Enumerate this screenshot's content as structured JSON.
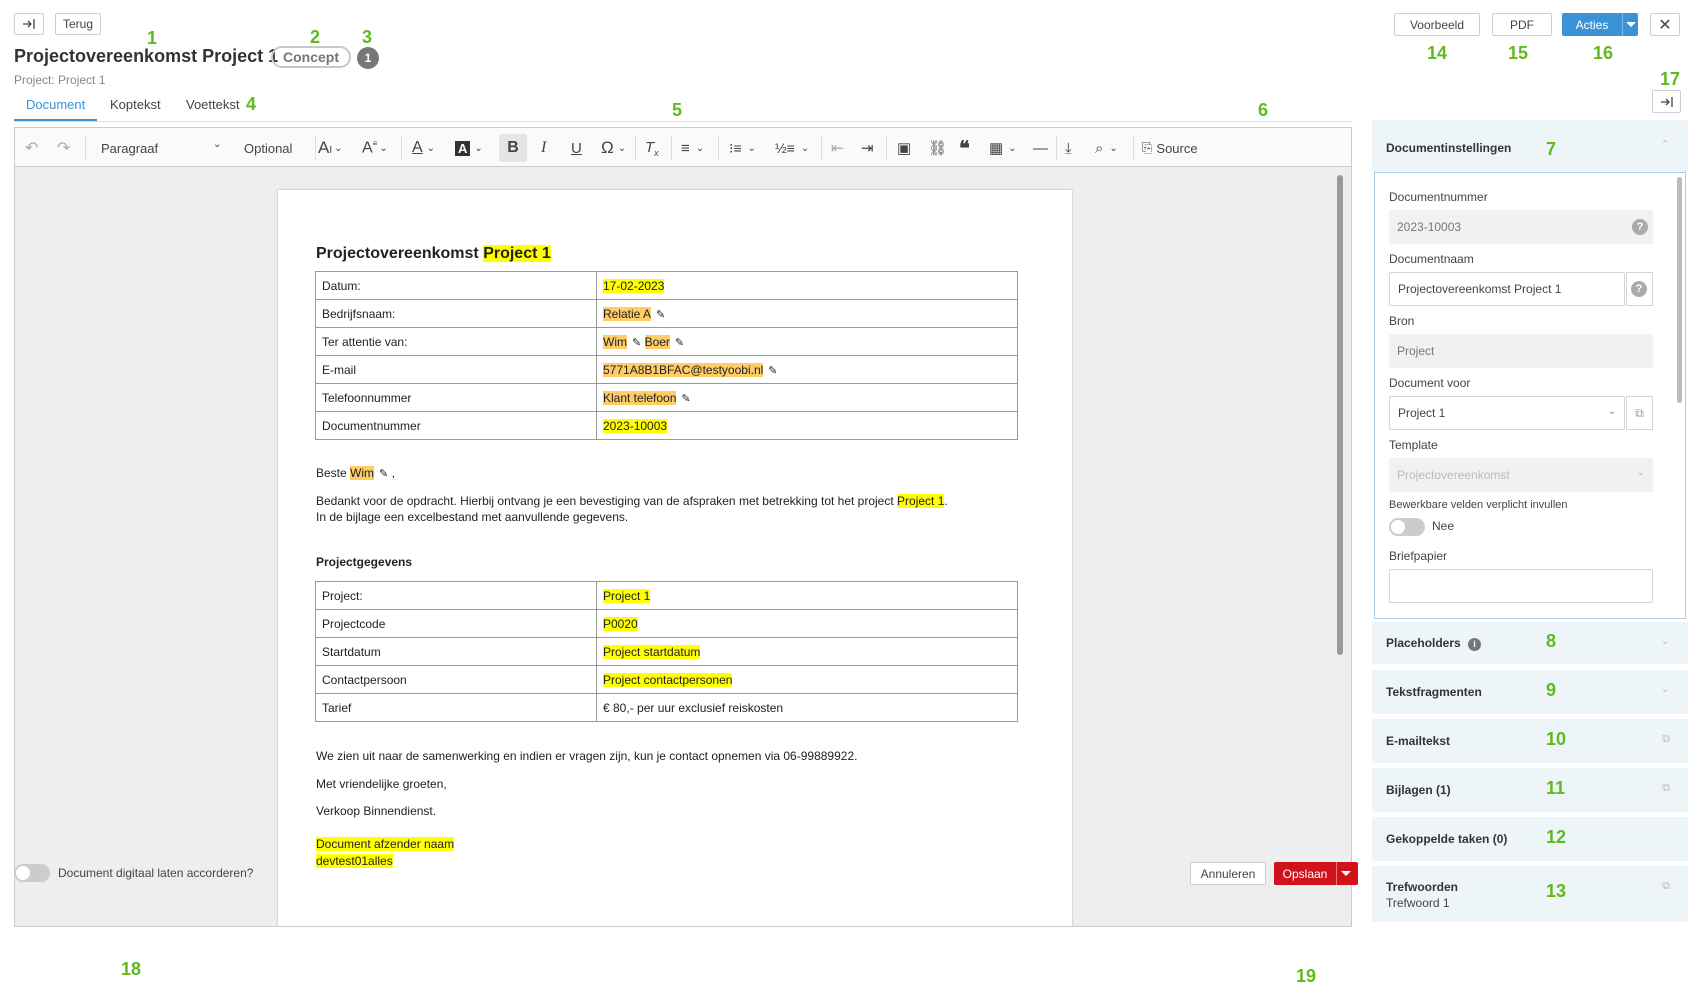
{
  "header": {
    "collapse_icon": "arrow-right-to-bar-icon",
    "back_label": "Terug",
    "title": "Projectovereenkomst Project 1",
    "status_badge": "Concept",
    "count_badge": "1",
    "subtitle": "Project: Project 1",
    "preview_label": "Voorbeeld",
    "pdf_label": "PDF",
    "actions_label": "Acties",
    "close_icon": "close-icon"
  },
  "tabs": [
    {
      "label": "Document",
      "active": true
    },
    {
      "label": "Koptekst",
      "active": false
    },
    {
      "label": "Voettekst",
      "active": false
    }
  ],
  "toolbar": {
    "paragraph_select": "Paragraaf",
    "optional_label": "Optional",
    "source_label": "Source"
  },
  "document": {
    "title_prefix": "Projectovereenkomst ",
    "title_highlight": "Project 1",
    "info_table": [
      {
        "label": "Datum:",
        "values": [
          "17-02-2023"
        ],
        "editable": false,
        "style": "yellow"
      },
      {
        "label": "Bedrijfsnaam:",
        "values": [
          "Relatie A"
        ],
        "editable": true,
        "style": "orange"
      },
      {
        "label": "Ter attentie van:",
        "values": [
          "Wim",
          "Boer"
        ],
        "editable": true,
        "style": "orange"
      },
      {
        "label": "E-mail",
        "values": [
          "5771A8B1BFAC@testyoobi.nl"
        ],
        "editable": true,
        "style": "orange"
      },
      {
        "label": "Telefoonnummer",
        "values": [
          "Klant telefoon"
        ],
        "editable": true,
        "style": "orange"
      },
      {
        "label": "Documentnummer",
        "values": [
          "2023-10003"
        ],
        "editable": false,
        "style": "yellow"
      }
    ],
    "greeting_prefix": "Beste ",
    "greeting_name": "Wim",
    "greeting_suffix": " ,",
    "body_line1_prefix": "Bedankt voor de opdracht. Hierbij ontvang je een bevestiging van de afspraken met betrekking tot het project ",
    "body_line1_highlight": "Project 1",
    "body_line1_suffix": ".",
    "body_line2": "In de bijlage een excelbestand met aanvullende gegevens.",
    "section_heading": "Projectgegevens",
    "project_table": [
      {
        "label": "Project:",
        "value": "Project 1",
        "highlight": true
      },
      {
        "label": "Projectcode",
        "value": "P0020",
        "highlight": true
      },
      {
        "label": "Startdatum",
        "value": "Project startdatum",
        "highlight": true
      },
      {
        "label": "Contactpersoon",
        "value": "Project contactpersonen",
        "highlight": true
      },
      {
        "label": "Tarief",
        "value": "€ 80,- per uur exclusief reiskosten",
        "highlight": false
      }
    ],
    "closing_line": "We zien uit naar de samenwerking en indien er vragen zijn, kun je contact opnemen via 06-99889922.",
    "regards": "Met vriendelijke groeten,",
    "department": "Verkoop Binnendienst.",
    "sender_name": "Document afzender naam",
    "sender_user": "devtest01alles"
  },
  "footer": {
    "approve_toggle_label": "Document digitaal laten accorderen?",
    "cancel_label": "Annuleren",
    "save_label": "Opslaan"
  },
  "sidebar": {
    "settings_title": "Documentinstellingen",
    "fields": {
      "doc_number_label": "Documentnummer",
      "doc_number_value": "2023-10003",
      "doc_name_label": "Documentnaam",
      "doc_name_value": "Projectovereenkomst Project 1",
      "source_label": "Bron",
      "source_value": "Project",
      "doc_for_label": "Document voor",
      "doc_for_value": "Project 1",
      "template_label": "Template",
      "template_value": "Projectovereenkomst",
      "required_label": "Bewerkbare velden verplicht invullen",
      "required_value": "Nee",
      "letterhead_label": "Briefpapier"
    },
    "sections": {
      "placeholders": "Placeholders",
      "text_fragments": "Tekstfragmenten",
      "email_text": "E-mailtekst",
      "attachments": "Bijlagen (1)",
      "linked_tasks": "Gekoppelde taken (0)",
      "keywords": "Trefwoorden",
      "keywords_value": "Trefwoord 1"
    }
  },
  "annotations": [
    "1",
    "2",
    "3",
    "4",
    "5",
    "6",
    "7",
    "8",
    "9",
    "10",
    "11",
    "12",
    "13",
    "14",
    "15",
    "16",
    "17",
    "18",
    "19"
  ],
  "colors": {
    "accent": "#3a93d6",
    "save": "#d0121b",
    "annotation": "#5fba1e",
    "highlight": "#ffff00",
    "highlight_orange": "#ffcc66"
  }
}
